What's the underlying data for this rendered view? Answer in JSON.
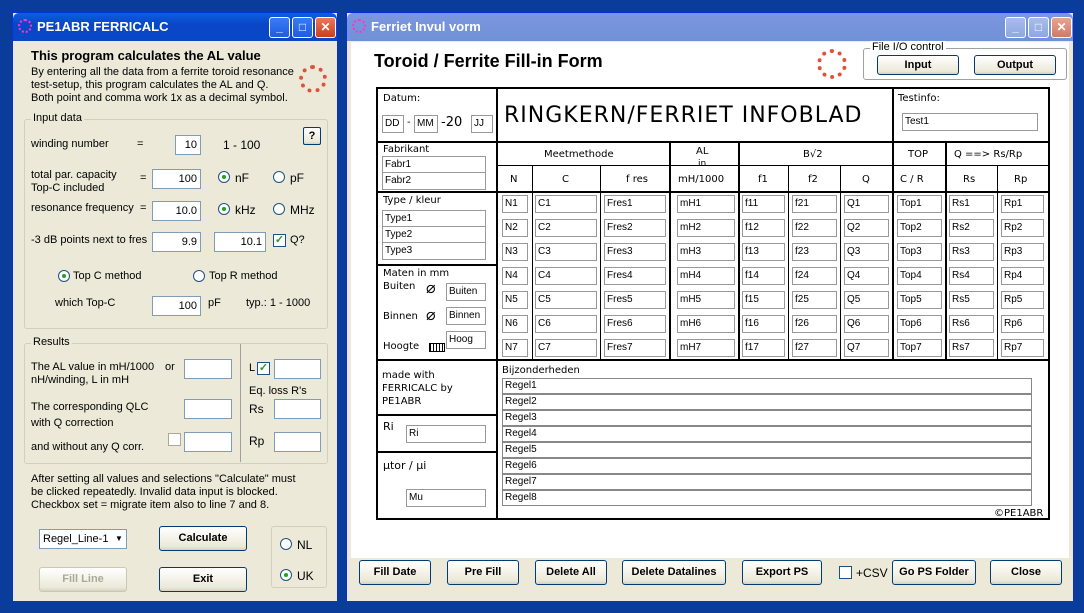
{
  "left": {
    "title": "PE1ABR FERRICALC",
    "heading": "This program calculates the AL value",
    "desc1": "By entering all the data from a ferrite toroid resonance",
    "desc2": "test-setup, this program calculates the AL and Q.",
    "desc3": "Both point and comma work 1x as a decimal symbol.",
    "input_group": "Input data",
    "winding_label": "winding number",
    "eq": "=",
    "winding_value": "10",
    "winding_range": "1 - 100",
    "help": "?",
    "cap_label1": "total par. capacity",
    "cap_label2": "Top-C included",
    "cap_value": "100",
    "nf": "nF",
    "pf": "pF",
    "freq_label": "resonance frequency",
    "freq_value": "10.0",
    "khz": "kHz",
    "mhz": "MHz",
    "db_label": "-3 dB points next to fres",
    "db_low": "9.9",
    "db_high": "10.1",
    "q_label": "Q?",
    "topc_method": "Top C method",
    "topr_method": "Top R method",
    "which_topc": "which Top-C",
    "which_topc_value": "100",
    "which_topc_unit": "pF",
    "typ_range": "typ.: 1 - 1000",
    "results_group": "Results",
    "al_label1": "The AL value in mH/1000",
    "al_or": "or",
    "al_label2": "nH/winding,    L in mH",
    "l_label": "L",
    "eq_loss": "Eq. loss R's",
    "qlc_label1": "The corresponding QLC",
    "qlc_label2": "with Q correction",
    "rs": "Rs",
    "noq_label": "and without any Q corr.",
    "rp": "Rp",
    "note1": "After setting all values and selections \"Calculate\" must",
    "note2": "be clicked repeatedly.   Invalid data input is blocked.",
    "note3": "Checkbox set = migrate item also to line 7 and 8.",
    "dropdown": "Regel_Line-1",
    "calculate": "Calculate",
    "fill_line": "Fill Line",
    "exit": "Exit",
    "nl": "NL",
    "uk": "UK"
  },
  "right": {
    "title": "Ferriet Invul vorm",
    "heading": "Toroid / Ferrite Fill-in Form",
    "fileio": "File I/O control",
    "input_btn": "Input",
    "output_btn": "Output",
    "datum": "Datum:",
    "dd": "DD",
    "mm": "MM",
    "dash": "-",
    "yr": "-20",
    "jj": "JJ",
    "banner": "RINGKERN/FERRIET  INFOBLAD",
    "testinfo": "Testinfo:",
    "testinfo_val": "Test1",
    "fabrikant": "Fabrikant",
    "fabr1": "Fabr1",
    "fabr2": "Fabr2",
    "meetmethode": "Meetmethode",
    "al_h1": "AL",
    "al_h2": "in",
    "al_h3": "mH/1000",
    "bw": "B√2",
    "top": "TOP",
    "q_rs": "Q ==> Rs/Rp",
    "col_n": "N",
    "col_c": "C",
    "col_fres": "f res",
    "col_f1": "f1",
    "col_f2": "f2",
    "col_q": "Q",
    "col_cr": "C / R",
    "col_rs": "Rs",
    "col_rp": "Rp",
    "type_kleur": "Type / kleur",
    "type1": "Type1",
    "type2": "Type2",
    "type3": "Type3",
    "maten": "Maten in mm",
    "buiten": "Buiten",
    "buiten_val": "Buiten",
    "binnen": "Binnen",
    "binnen_val": "Binnen",
    "hoogte": "Hoogte",
    "hoogte_val": "Hoog",
    "rows": [
      [
        "N1",
        "C1",
        "Fres1",
        "mH1",
        "f11",
        "f21",
        "Q1",
        "Top1",
        "Rs1",
        "Rp1"
      ],
      [
        "N2",
        "C2",
        "Fres2",
        "mH2",
        "f12",
        "f22",
        "Q2",
        "Top2",
        "Rs2",
        "Rp2"
      ],
      [
        "N3",
        "C3",
        "Fres3",
        "mH3",
        "f13",
        "f23",
        "Q3",
        "Top3",
        "Rs3",
        "Rp3"
      ],
      [
        "N4",
        "C4",
        "Fres4",
        "mH4",
        "f14",
        "f24",
        "Q4",
        "Top4",
        "Rs4",
        "Rp4"
      ],
      [
        "N5",
        "C5",
        "Fres5",
        "mH5",
        "f15",
        "f25",
        "Q5",
        "Top5",
        "Rs5",
        "Rp5"
      ],
      [
        "N6",
        "C6",
        "Fres6",
        "mH6",
        "f16",
        "f26",
        "Q6",
        "Top6",
        "Rs6",
        "Rp6"
      ],
      [
        "N7",
        "C7",
        "Fres7",
        "mH7",
        "f17",
        "f27",
        "Q7",
        "Top7",
        "Rs7",
        "Rp7"
      ]
    ],
    "made1": "made with",
    "made2": "FERRICALC by",
    "made3": "PE1ABR",
    "ri_label": "Ri",
    "ri_val": "Ri",
    "mu_label": "µtor / µi",
    "mu_val": "Mu",
    "bijz": "Bijzonderheden",
    "regels": [
      "Regel1",
      "Regel2",
      "Regel3",
      "Regel4",
      "Regel5",
      "Regel6",
      "Regel7",
      "Regel8"
    ],
    "copyright": "©PE1ABR",
    "btn_filldate": "Fill Date",
    "btn_prefill": "Pre Fill",
    "btn_deleteall": "Delete All",
    "btn_deletedata": "Delete Datalines",
    "btn_exportps": "Export PS",
    "csv": "+CSV",
    "btn_psfolder": "Go PS Folder",
    "btn_close": "Close"
  }
}
